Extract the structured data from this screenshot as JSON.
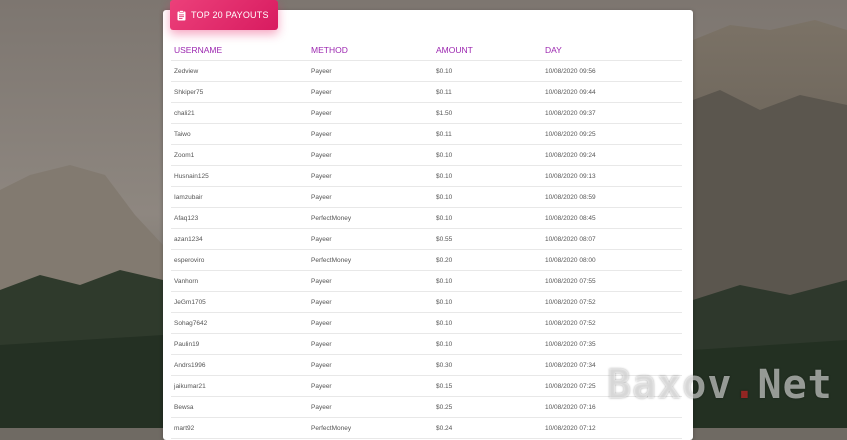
{
  "card": {
    "title": "TOP 20 PAYOUTS",
    "icon": "clipboard-icon"
  },
  "table": {
    "columns": [
      "USERNAME",
      "METHOD",
      "AMOUNT",
      "DAY"
    ],
    "rows": [
      [
        "Zedview",
        "Payeer",
        "$0.10",
        "10/08/2020 09:56"
      ],
      [
        "Shkiper75",
        "Payeer",
        "$0.11",
        "10/08/2020 09:44"
      ],
      [
        "chali21",
        "Payeer",
        "$1.50",
        "10/08/2020 09:37"
      ],
      [
        "Taiwo",
        "Payeer",
        "$0.11",
        "10/08/2020 09:25"
      ],
      [
        "Zoom1",
        "Payeer",
        "$0.10",
        "10/08/2020 09:24"
      ],
      [
        "Husnain125",
        "Payeer",
        "$0.10",
        "10/08/2020 09:13"
      ],
      [
        "Iamzubair",
        "Payeer",
        "$0.10",
        "10/08/2020 08:59"
      ],
      [
        "Afaq123",
        "PerfectMoney",
        "$0.10",
        "10/08/2020 08:45"
      ],
      [
        "azan1234",
        "Payeer",
        "$0.55",
        "10/08/2020 08:07"
      ],
      [
        "esperoviro",
        "PerfectMoney",
        "$0.20",
        "10/08/2020 08:00"
      ],
      [
        "Vanhorn",
        "Payeer",
        "$0.10",
        "10/08/2020 07:55"
      ],
      [
        "JeGm1705",
        "Payeer",
        "$0.10",
        "10/08/2020 07:52"
      ],
      [
        "Sohag7642",
        "Payeer",
        "$0.10",
        "10/08/2020 07:52"
      ],
      [
        "Paulin19",
        "Payeer",
        "$0.10",
        "10/08/2020 07:35"
      ],
      [
        "Andrs1996",
        "Payeer",
        "$0.30",
        "10/08/2020 07:34"
      ],
      [
        "jaikumar21",
        "Payeer",
        "$0.15",
        "10/08/2020 07:25"
      ],
      [
        "Bewsa",
        "Payeer",
        "$0.25",
        "10/08/2020 07:16"
      ],
      [
        "mart92",
        "PerfectMoney",
        "$0.24",
        "10/08/2020 07:12"
      ]
    ]
  },
  "watermark": {
    "left": "Baxov",
    "dot": ".",
    "right": "Net"
  },
  "colors": {
    "header_accent": "#e91e63",
    "column_header": "#9c27b0"
  }
}
